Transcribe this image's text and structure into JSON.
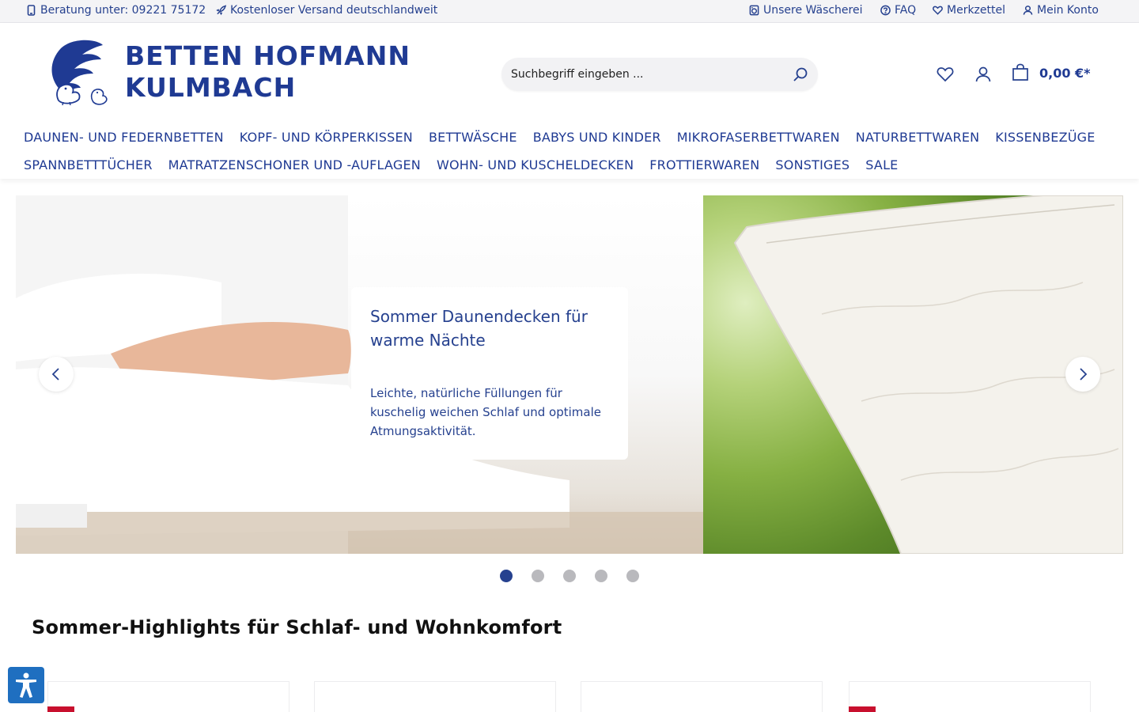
{
  "topbar": {
    "phone": "Beratung unter: 09221 75172",
    "shipping": "Kostenloser Versand deutschlandweit",
    "laundry": "Unsere Wäscherei",
    "faq": "FAQ",
    "wishlist": "Merkzettel",
    "account": "Mein Konto"
  },
  "logo": {
    "line1": "BETTEN HOFMANN",
    "line2": "KULMBACH"
  },
  "search": {
    "placeholder": "Suchbegriff eingeben ..."
  },
  "cart": {
    "total": "0,00 €*"
  },
  "nav": {
    "row1": [
      "DAUNEN- UND FEDERNBETTEN",
      "KOPF- UND KÖRPERKISSEN",
      "BETTWÄSCHE",
      "BABYS UND KINDER",
      "MIKROFASERBETTWAREN",
      "NATURBETTWAREN",
      "KISSENBEZÜGE"
    ],
    "row2": [
      "SPANNBETTTÜCHER",
      "MATRATZENSCHONER UND -AUFLAGEN",
      "WOHN- UND KUSCHELDECKEN",
      "FROTTIERWAREN",
      "SONSTIGES",
      "SALE"
    ]
  },
  "slider": {
    "heading": "Sommer Daunendecken für warme Nächte",
    "text": "Leichte, natürliche Füllungen für kuschelig weichen Schlaf und optimale Atmungsaktivität.",
    "dot_count": 5,
    "active_dot": 1
  },
  "section": {
    "title": "Sommer-Highlights für Schlaf- und Wohnkomfort"
  },
  "colors": {
    "brand": "#1f3a93",
    "sale_badge": "#c8102e",
    "accessibility": "#1f6fc0"
  }
}
